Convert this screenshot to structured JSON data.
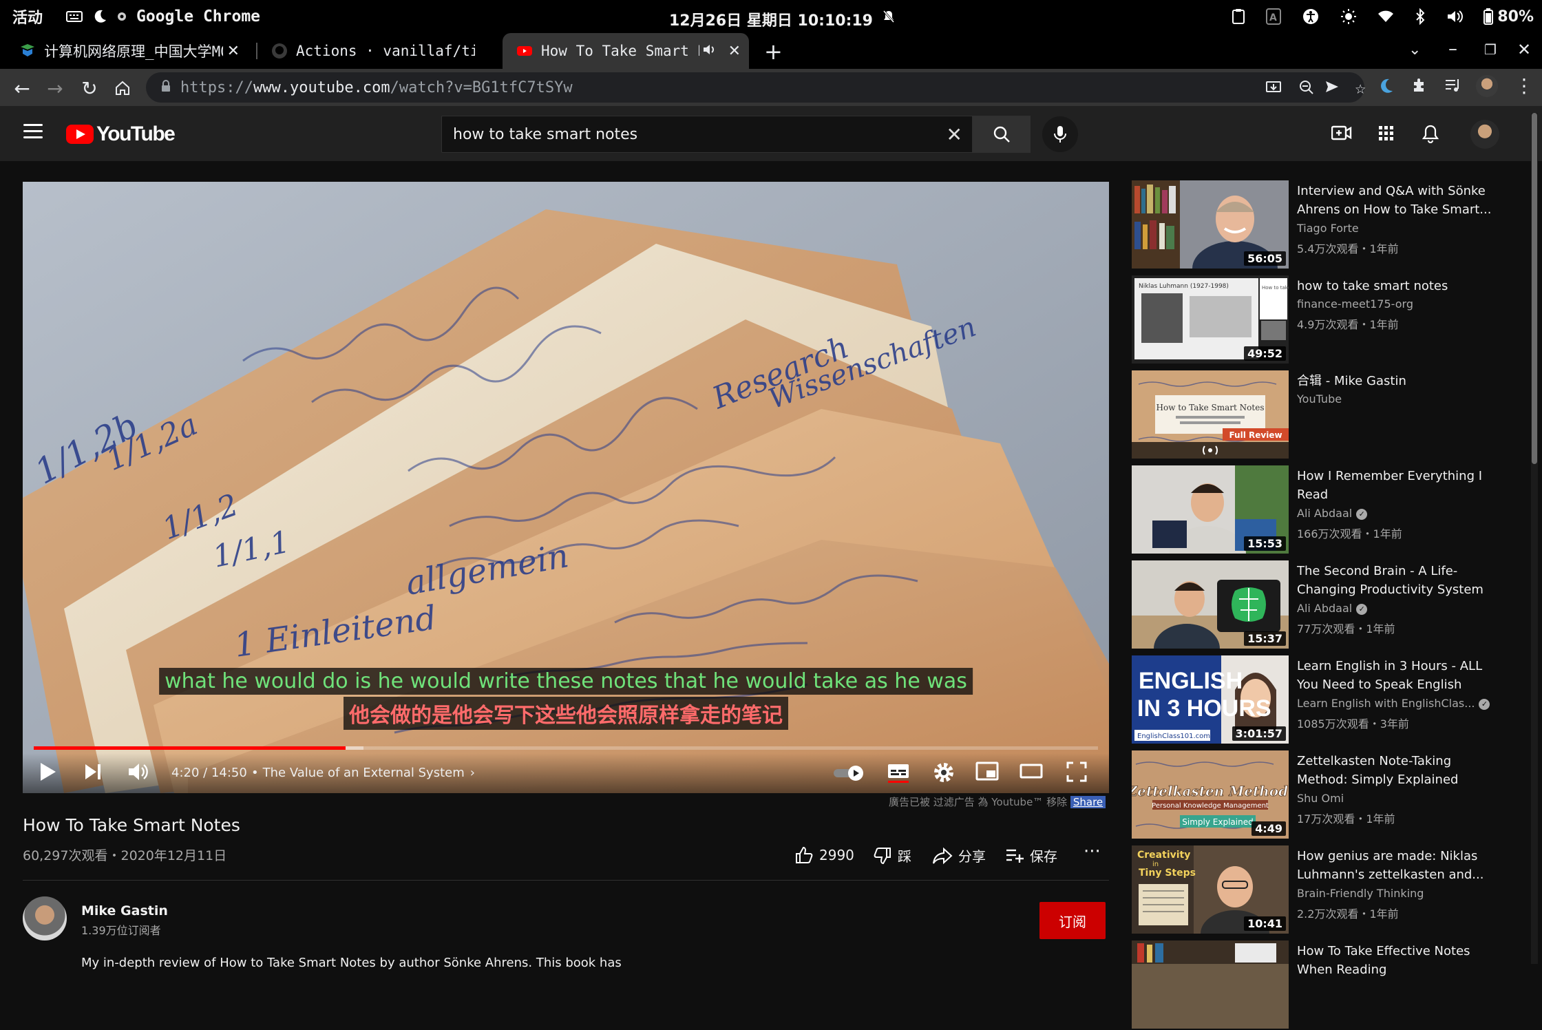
{
  "system": {
    "activities": "活动",
    "app_name": "Google Chrome",
    "clock": "12月26日 星期日 10:10:19",
    "battery": "80%"
  },
  "tabs": [
    {
      "title": "计算机网络原理_中国大学MOOC",
      "icon": "mooc-favicon"
    },
    {
      "title": "Actions · vanillaf/tic",
      "icon": "github-favicon"
    },
    {
      "title": "How To Take Smart Notes",
      "icon": "youtube-favicon",
      "audio": true
    }
  ],
  "omnibox": {
    "scheme": "https://",
    "host": "www.youtube.com",
    "path": "/watch?v=BG1tfC7tSYw"
  },
  "youtube": {
    "logo_text": "YouTube",
    "search_value": "how to take smart notes"
  },
  "player": {
    "caption_line1": "what he would do is he would write these notes that he would take as he was",
    "caption_line2": "他会做的是他会写下这些他会照原样拿走的笔记",
    "time": "4:20 / 14:50",
    "chapter": "The Value of an External System",
    "progress_fraction": 0.293,
    "buffered_fraction": 0.31,
    "note_text": [
      "1/1,2b",
      "1/1,2a",
      "1/1,2",
      "1/1,1",
      "1 Einleitend",
      "Research",
      "Wissenschaften",
      "allgemein"
    ]
  },
  "ad_note": {
    "text": "廣告已被 过滤广告 為 Youtube™ 移除",
    "share": "Share"
  },
  "video": {
    "title": "How To Take Smart Notes",
    "meta": "60,297次观看・2020年12月11日",
    "likes": "2990",
    "dislike": "踩",
    "share": "分享",
    "save": "保存"
  },
  "channel": {
    "name": "Mike Gastin",
    "subscribers": "1.39万位订阅者",
    "subscribe": "订阅",
    "description": "My in-depth review of How to Take Smart Notes by author Sönke Ahrens. This book has"
  },
  "recommendations": [
    {
      "title": "Interview and Q&A with Sönke Ahrens on How to Take Smart...",
      "channel": "Tiago Forte",
      "meta": "5.4万次观看・1年前",
      "duration": "56:05",
      "verified": false
    },
    {
      "title": "how to take smart notes",
      "channel": "finance-meet175-org",
      "meta": "4.9万次观看・1年前",
      "duration": "49:52",
      "verified": false
    },
    {
      "title": "合辑 - Mike Gastin",
      "channel": "YouTube",
      "meta": "",
      "duration": "",
      "verified": false
    },
    {
      "title": "How I Remember Everything I Read",
      "channel": "Ali Abdaal",
      "meta": "166万次观看・1年前",
      "duration": "15:53",
      "verified": true
    },
    {
      "title": "The Second Brain - A Life-Changing Productivity System",
      "channel": "Ali Abdaal",
      "meta": "77万次观看・1年前",
      "duration": "15:37",
      "verified": true
    },
    {
      "title": "Learn English in 3 Hours - ALL You Need to Speak English",
      "channel": "Learn English with EnglishClas...",
      "meta": "1085万次观看・3年前",
      "duration": "3:01:57",
      "verified": true
    },
    {
      "title": "Zettelkasten Note-Taking Method: Simply Explained",
      "channel": "Shu Omi",
      "meta": "17万次观看・1年前",
      "duration": "4:49",
      "verified": false
    },
    {
      "title": "How genius are made: Niklas Luhmann's zettelkasten and...",
      "channel": "Brain-Friendly Thinking",
      "meta": "2.2万次观看・1年前",
      "duration": "10:41",
      "verified": false
    },
    {
      "title": "How To Take Effective Notes When Reading",
      "channel": "",
      "meta": "",
      "duration": "",
      "verified": false
    }
  ],
  "thumb_text": {
    "t2_heading": "Niklas Luhmann (1927-1998)",
    "t2_right": "How to take smart notes",
    "t3_card": "How to Take Smart Notes",
    "t3_badge": "Full Review",
    "t6_line1": "ENGLISH",
    "t6_line2": "IN 3 HOURS",
    "t6_site": "EnglishClass101.com",
    "t7_line1": "Zettelkasten Method:",
    "t7_line2": "Personal Knowledge Management",
    "t7_badge": "Simply Explained",
    "t8_line1": "Creativity",
    "t8_line2": "in",
    "t8_line3": "Tiny Steps"
  },
  "colors": {
    "youtube_red": "#ff0000",
    "caption_green": "#6fe27a",
    "caption_red": "#ff6b6b",
    "subscribe_red": "#cc0000"
  }
}
